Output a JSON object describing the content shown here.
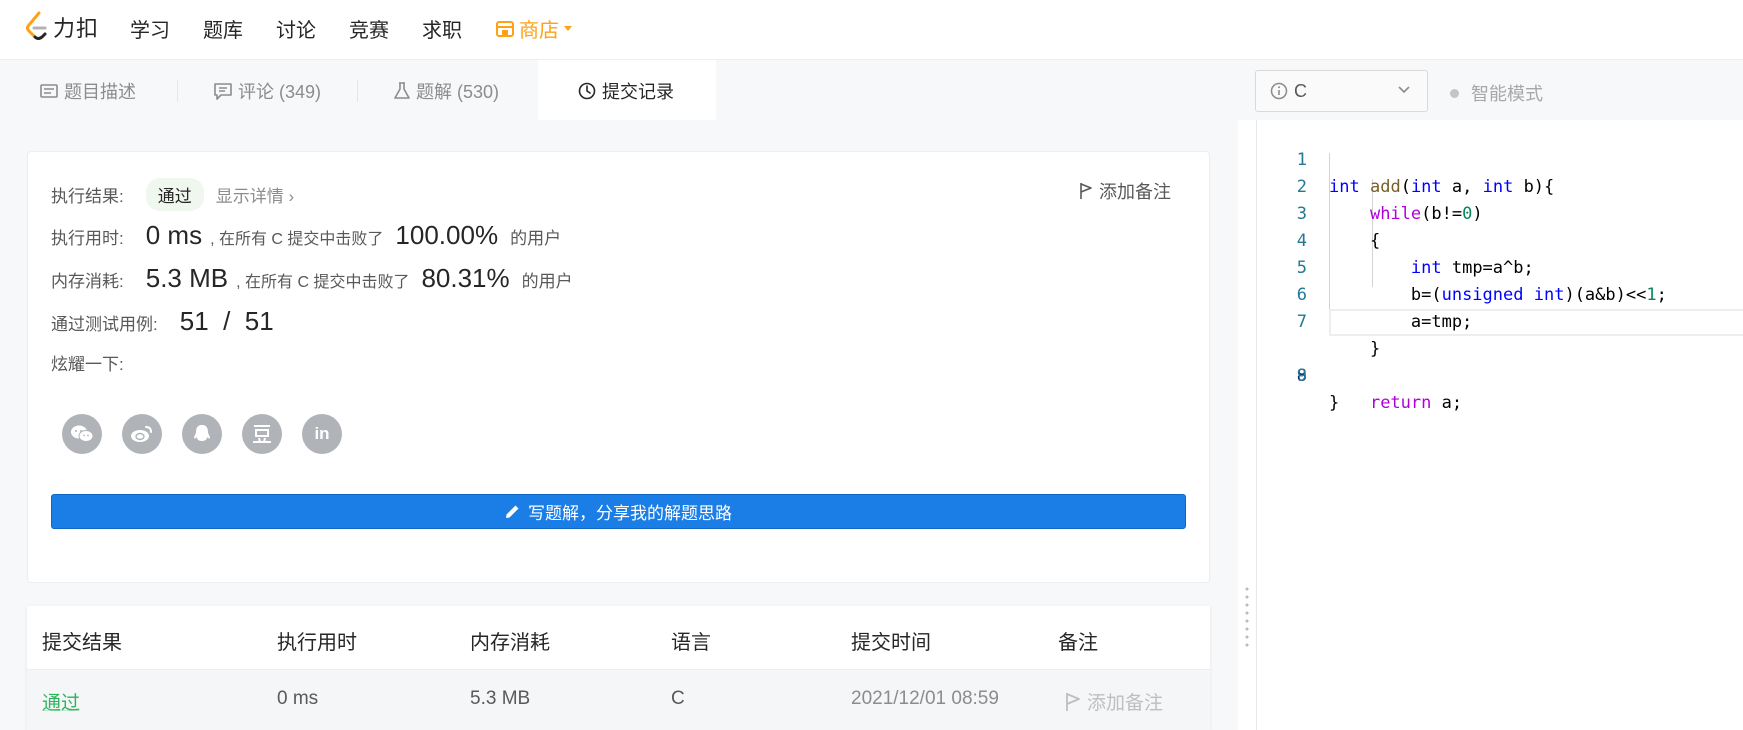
{
  "nav": {
    "logo_text": "力扣",
    "items": [
      "学习",
      "题库",
      "讨论",
      "竞赛",
      "求职"
    ],
    "shop": "商店"
  },
  "tabs": {
    "description": "题目描述",
    "comments": "评论 (349)",
    "solutions": "题解 (530)",
    "submissions": "提交记录"
  },
  "editor_bar": {
    "language": "C",
    "smart_mode": "智能模式"
  },
  "result": {
    "status_label": "执行结果:",
    "status": "通过",
    "details_link": "显示详情 ›",
    "add_note": "添加备注",
    "runtime_label": "执行用时:",
    "runtime": "0 ms",
    "runtime_beat_text": ", 在所有 C 提交中击败了",
    "runtime_pct": "100.00%",
    "users_text": "的用户",
    "memory_label": "内存消耗:",
    "memory": "5.3 MB",
    "memory_beat_text": ", 在所有 C 提交中击败了",
    "memory_pct": "80.31%",
    "tests_label": "通过测试用例:",
    "tests": "51  /  51",
    "share_label": "炫耀一下:",
    "share_icons": [
      "wechat-icon",
      "weibo-icon",
      "qq-icon",
      "douban-icon",
      "linkedin-icon"
    ],
    "linkedin_glyph": "in",
    "write_button": "写题解，分享我的解题思路"
  },
  "submission_table": {
    "headers": [
      "提交结果",
      "执行用时",
      "内存消耗",
      "语言",
      "提交时间",
      "备注"
    ],
    "rows": [
      {
        "result": "通过",
        "runtime": "0 ms",
        "memory": "5.3 MB",
        "language": "C",
        "time": "2021/12/01 08:59",
        "note": "添加备注"
      }
    ]
  },
  "code": {
    "line_numbers": [
      "1",
      "2",
      "3",
      "4",
      "5",
      "6",
      "7",
      "8",
      "9"
    ]
  },
  "colors": {
    "accent_blue": "#1a7ee6",
    "success_green": "#2db55d",
    "shop_orange": "#ffa116"
  }
}
